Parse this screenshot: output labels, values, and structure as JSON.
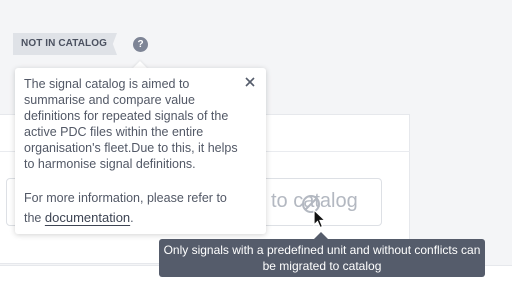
{
  "status_tag": {
    "label": "NOT IN CATALOG"
  },
  "help_icon": {
    "glyph": "?"
  },
  "migrate_button": {
    "label": "to catalog"
  },
  "popover": {
    "body": "The signal catalog is aimed to summarise and compare value definitions for repeated signals of the active PDC files within the entire organisation's fleet.Due to this, it helps to harmonise signal definitions.",
    "more_prefix": "For more information, please refer to the",
    "link_label": "documentation",
    "more_suffix": "."
  },
  "tooltip": {
    "text": "Only signals with a predefined unit and without conflicts can be migrated to catalog"
  },
  "colors": {
    "tag_bg": "#dfe2e7",
    "help_icon_bg": "#7e8596",
    "tooltip_bg": "#555c6b",
    "disabled_text": "#b3b8c1"
  }
}
